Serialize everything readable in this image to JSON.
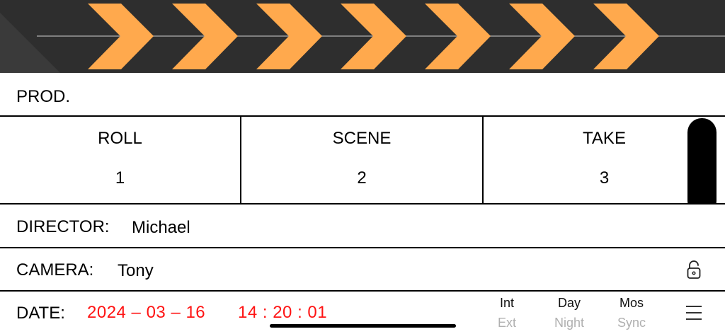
{
  "clapper": {
    "chevron_color": "#ffa94d",
    "background_color": "#2e2e2e"
  },
  "prod": {
    "label": "PROD."
  },
  "slate": {
    "roll": {
      "label": "ROLL",
      "value": "1"
    },
    "scene": {
      "label": "SCENE",
      "value": "2"
    },
    "take": {
      "label": "TAKE",
      "value": "3"
    }
  },
  "director": {
    "label": "DIRECTOR:",
    "value": "Michael"
  },
  "camera": {
    "label": "CAMERA:",
    "value": "Tony",
    "lock_icon": "unlock-icon"
  },
  "date": {
    "label": "DATE:",
    "date_value": "2024 – 03 – 16",
    "time_value": "14 : 20 : 01",
    "value_color": "#ff1414"
  },
  "toggles": [
    {
      "active": "Int",
      "inactive": "Ext"
    },
    {
      "active": "Day",
      "inactive": "Night"
    },
    {
      "active": "Mos",
      "inactive": "Sync"
    }
  ],
  "menu_icon": "hamburger-menu-icon"
}
